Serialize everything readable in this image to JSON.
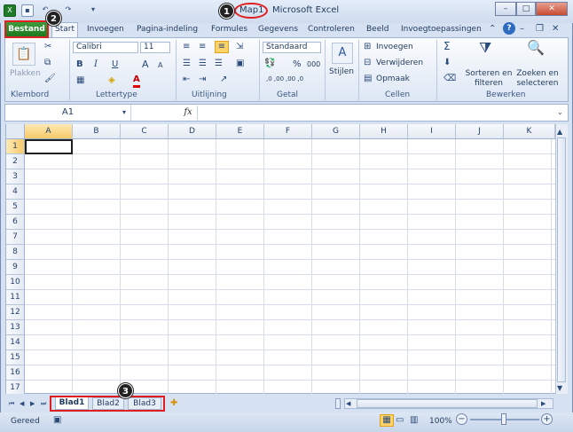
{
  "app": {
    "doc_name": "Map1",
    "app_name": "Microsoft Excel"
  },
  "window_controls": {
    "minimize": "–",
    "maximize": "□",
    "close": "✕"
  },
  "qat": {
    "undo": "↶",
    "redo": "↷",
    "more": "▾"
  },
  "tabs": {
    "file": "Bestand",
    "items": [
      "Start",
      "Invoegen",
      "Pagina-indeling",
      "Formules",
      "Gegevens",
      "Controleren",
      "Beeld",
      "Invoegtoepassingen"
    ]
  },
  "ribbon": {
    "clipboard": {
      "paste": "Plakken",
      "label": "Klembord"
    },
    "font": {
      "name": "Calibri",
      "size": "11",
      "label": "Lettertype",
      "bold": "B",
      "italic": "I",
      "underline": "U",
      "grow": "A",
      "shrink": "A",
      "color_a": "A"
    },
    "alignment": {
      "label": "Uitlijning"
    },
    "number": {
      "format": "Standaard",
      "percent": "%",
      "thousands": "000",
      "dec_inc": ",0 ,00",
      "dec_dec": ",00 ,0",
      "label": "Getal"
    },
    "styles": {
      "label": "Stijlen"
    },
    "cells": {
      "insert": "Invoegen",
      "delete": "Verwijderen",
      "format": "Opmaak",
      "label": "Cellen"
    },
    "editing": {
      "sigma": "Σ",
      "sort": "Sorteren en filteren",
      "find": "Zoeken en selecteren",
      "label": "Bewerken"
    }
  },
  "formula_bar": {
    "name_box": "A1",
    "fx": "fx",
    "value": ""
  },
  "columns": [
    "A",
    "B",
    "C",
    "D",
    "E",
    "F",
    "G",
    "H",
    "I",
    "J",
    "K"
  ],
  "rows": [
    "1",
    "2",
    "3",
    "4",
    "5",
    "6",
    "7",
    "8",
    "9",
    "10",
    "11",
    "12",
    "13",
    "14",
    "15",
    "16",
    "17"
  ],
  "sheets": [
    "Blad1",
    "Blad2",
    "Blad3"
  ],
  "status": {
    "ready": "Gereed",
    "zoom": "100%",
    "zoom_minus": "−",
    "zoom_plus": "+"
  },
  "callouts": [
    "1",
    "2",
    "3"
  ],
  "colors": {
    "file_tab": "#2a8a2a",
    "highlight": "#e02020",
    "callout": "#222222"
  }
}
